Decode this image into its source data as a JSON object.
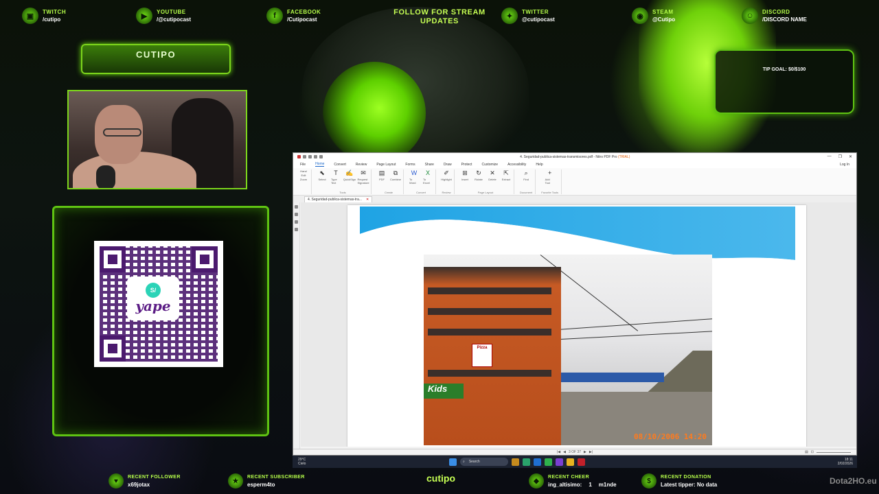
{
  "socials": [
    {
      "name": "TWITCH",
      "handle": "/cutipo",
      "icon": "twitch-icon",
      "glyph": "▣"
    },
    {
      "name": "YOUTUBE",
      "handle": "/@cutipocast",
      "icon": "youtube-icon",
      "glyph": "▶"
    },
    {
      "name": "FACEBOOK",
      "handle": "/Cutipocast",
      "icon": "facebook-icon",
      "glyph": "f"
    },
    {
      "name": "TWITTER",
      "handle": "@cutipocast",
      "icon": "twitter-icon",
      "glyph": "✦"
    },
    {
      "name": "STEAM",
      "handle": "@Cutipo",
      "icon": "steam-icon",
      "glyph": "◉"
    },
    {
      "name": "DISCORD",
      "handle": "/DISCORD NAME",
      "icon": "discord-icon",
      "glyph": "☺"
    }
  ],
  "follow_text": "FOLLOW FOR STREAM UPDATES",
  "nameplate": "CUTIPO",
  "qr": {
    "badge": "S/",
    "brand": "yape"
  },
  "tip_goal": "TIP GOAL: $0/$100",
  "pdf_app": {
    "title": "4. Seguridad-publica-sistemas-transmisores.pdf - Nitro PDF Pro",
    "title_badge": "(TRIAL)",
    "window_controls": [
      "—",
      "❐",
      "✕"
    ],
    "menu": [
      "File",
      "Home",
      "Convert",
      "Review",
      "Page Layout",
      "Forms",
      "Share",
      "Draw",
      "Protect",
      "Customize",
      "Accessibility",
      "Help"
    ],
    "active_menu": "Home",
    "login": "Log In",
    "ribbon_groups": [
      {
        "name": "",
        "tools": [
          {
            "label": "Hand",
            "glyph": "✋"
          },
          {
            "label": "Edit",
            "glyph": "✎"
          },
          {
            "label": "Zoom",
            "glyph": "⌕"
          }
        ]
      },
      {
        "name": "Tools",
        "tools": [
          {
            "label": "Select",
            "glyph": "⬉"
          },
          {
            "label": "Type Text",
            "glyph": "T"
          },
          {
            "label": "QuickSign",
            "glyph": "✍"
          },
          {
            "label": "Request Signature",
            "glyph": "✉"
          }
        ]
      },
      {
        "name": "Create",
        "tools": [
          {
            "label": "PDF",
            "glyph": "▤"
          },
          {
            "label": "Combine",
            "glyph": "⧉"
          }
        ]
      },
      {
        "name": "Convert",
        "tools": [
          {
            "label": "To Word",
            "glyph": "W"
          },
          {
            "label": "To Excel",
            "glyph": "X"
          }
        ]
      },
      {
        "name": "Review",
        "tools": [
          {
            "label": "Highlight",
            "glyph": "✐"
          }
        ]
      },
      {
        "name": "Page Layout",
        "tools": [
          {
            "label": "Insert",
            "glyph": "⊞"
          },
          {
            "label": "Rotate",
            "glyph": "↻"
          },
          {
            "label": "Delete",
            "glyph": "✕"
          },
          {
            "label": "Extract",
            "glyph": "⇱"
          }
        ]
      },
      {
        "name": "Document",
        "tools": [
          {
            "label": "Find",
            "glyph": "⌕"
          }
        ]
      },
      {
        "name": "Favorite Tools",
        "tools": [
          {
            "label": "Add Tool",
            "glyph": "+"
          }
        ]
      }
    ],
    "doc_tab": "4. Seguridad-publica-sistemas-tra...",
    "doc_tab_close": "✕",
    "photo_pizza": "Pizza",
    "photo_kids": "Kids",
    "photo_date": "08/10/2006 14:20",
    "page_indicator": "3 OF 37"
  },
  "taskbar": {
    "weather_temp": "29°C",
    "weather_desc": "Cielo",
    "search": "Search",
    "time": "18:11",
    "date": "2/02/2026"
  },
  "bottom": {
    "follower_title": "RECENT FOLLOWER",
    "follower": "x69jotax",
    "subscriber_title": "RECENT SUBSCRIBER",
    "subscriber": "esperm4to",
    "brand": "cutipo",
    "cheer_title": "RECENT CHEER",
    "cheer_user": "ing_altisimo:",
    "cheer_amount": "1",
    "cheer_msg": "m1nde",
    "donation_title": "RECENT DONATION",
    "donation": "Latest tipper: No data",
    "watermark": "Dota2HO.eu"
  }
}
